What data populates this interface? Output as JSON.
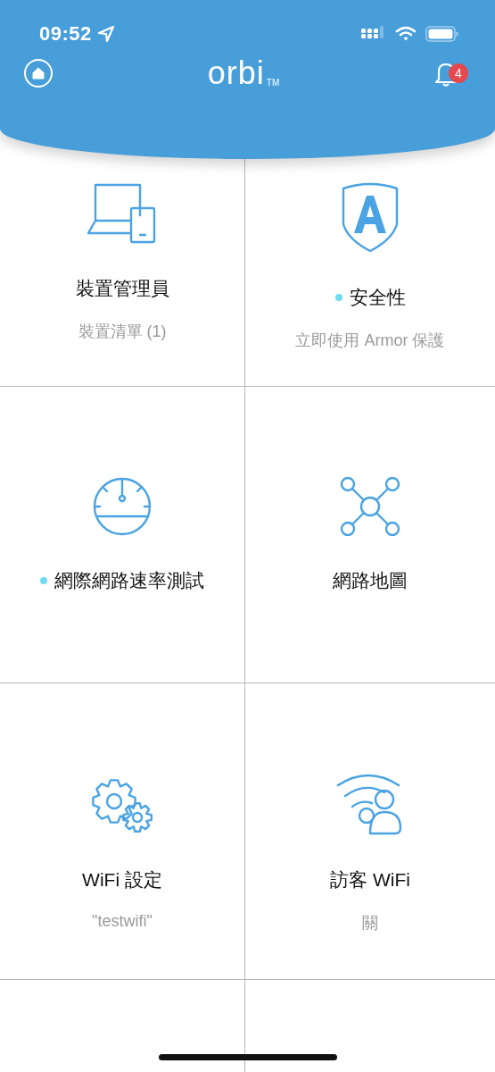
{
  "status_bar": {
    "time": "09:52"
  },
  "header": {
    "logo": "orbi",
    "logo_mark": "TM",
    "notification_count": "4"
  },
  "tiles": [
    {
      "kind": "devices",
      "title": "裝置管理員",
      "new": false,
      "subtitle": "裝置清單 (1)"
    },
    {
      "kind": "shield",
      "title": "安全性",
      "new": true,
      "subtitle": "立即使用 Armor 保護"
    },
    {
      "kind": "gauge",
      "title": "網際網路速率測試",
      "new": true
    },
    {
      "kind": "network",
      "title": "網路地圖",
      "new": false
    },
    {
      "kind": "gears",
      "title": "WiFi 設定",
      "new": false,
      "subtitle": "\"testwifi\""
    },
    {
      "kind": "guest",
      "title": "訪客 WiFi",
      "new": false,
      "subtitle": "關"
    }
  ]
}
